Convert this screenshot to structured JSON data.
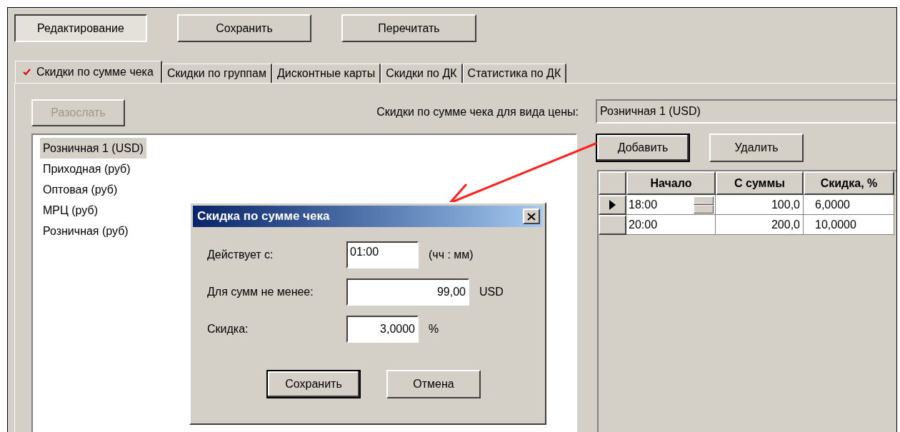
{
  "toolbar": [
    {
      "label": "Редактирование",
      "pressed": true
    },
    {
      "label": "Сохранить",
      "pressed": false
    },
    {
      "label": "Перечитать",
      "pressed": false
    }
  ],
  "tabs": [
    {
      "label": "Скидки по сумме чека",
      "selected": true,
      "checked": true
    },
    {
      "label": "Скидки по группам",
      "selected": false,
      "checked": false
    },
    {
      "label": "Дисконтные карты",
      "selected": false,
      "checked": false
    },
    {
      "label": "Скидки по ДК",
      "selected": false,
      "checked": false
    },
    {
      "label": "Статистика по ДК",
      "selected": false,
      "checked": false
    }
  ],
  "send_button": {
    "label": "Разослать",
    "disabled": true
  },
  "price_type": {
    "label": "Скидки по сумме чека для вида цены:",
    "value": "Розничная 1 (USD)"
  },
  "price_list": [
    {
      "label": "Розничная 1 (USD)",
      "selected": true
    },
    {
      "label": "Приходная (руб)",
      "selected": false
    },
    {
      "label": "Оптовая (руб)",
      "selected": false
    },
    {
      "label": "МРЦ (руб)",
      "selected": false
    },
    {
      "label": "Розничная (руб)",
      "selected": false
    }
  ],
  "grid_buttons": [
    {
      "label": "Добавить",
      "default": true
    },
    {
      "label": "Удалить",
      "default": false
    }
  ],
  "grid": {
    "columns": [
      "Начало",
      "С суммы",
      "Скидка, %"
    ],
    "rows": [
      {
        "current": true,
        "cells": [
          "18:00",
          "100,0",
          "6,0000"
        ]
      },
      {
        "current": false,
        "cells": [
          "20:00",
          "200,0",
          "10,0000"
        ]
      }
    ]
  },
  "dialog": {
    "title": "Скидка по сумме чека",
    "fields": [
      {
        "kind": "time",
        "label": "Действует с:",
        "value": "01:00",
        "unit": "(чч : мм)"
      },
      {
        "kind": "money",
        "label": "Для сумм не менее:",
        "value": "99,00",
        "unit": "USD"
      },
      {
        "kind": "percent",
        "label": "Скидка:",
        "value": "3,0000",
        "unit": "%"
      }
    ],
    "buttons": [
      {
        "label": "Сохранить",
        "default": true
      },
      {
        "label": "Отмена",
        "default": false
      }
    ]
  }
}
